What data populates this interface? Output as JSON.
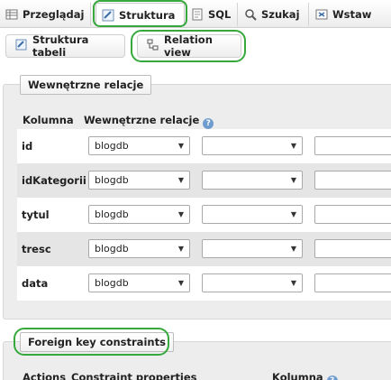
{
  "tabs": [
    {
      "label": "Przeglądaj",
      "icon": "browse-icon"
    },
    {
      "label": "Struktura",
      "icon": "structure-icon",
      "active": true
    },
    {
      "label": "SQL",
      "icon": "sql-icon"
    },
    {
      "label": "Szukaj",
      "icon": "search-icon"
    },
    {
      "label": "Wstaw",
      "icon": "insert-icon"
    }
  ],
  "subtabs": {
    "table_structure": "Struktura tabeli",
    "relation_view": "Relation view"
  },
  "internal": {
    "legend": "Wewnętrzne relacje",
    "col_column": "Kolumna",
    "col_relations": "Wewnętrzne relacje",
    "rows": [
      {
        "name": "id",
        "db": "blogdb"
      },
      {
        "name": "idKategorii",
        "db": "blogdb"
      },
      {
        "name": "tytul",
        "db": "blogdb"
      },
      {
        "name": "tresc",
        "db": "blogdb"
      },
      {
        "name": "data",
        "db": "blogdb"
      }
    ]
  },
  "foreign": {
    "legend": "Foreign key constraints",
    "col_actions": "Actions",
    "col_props": "Constraint properties",
    "col_column": "Kolumna"
  },
  "colors": {
    "highlight": "#36a83c",
    "help": "#6f9ccf"
  }
}
